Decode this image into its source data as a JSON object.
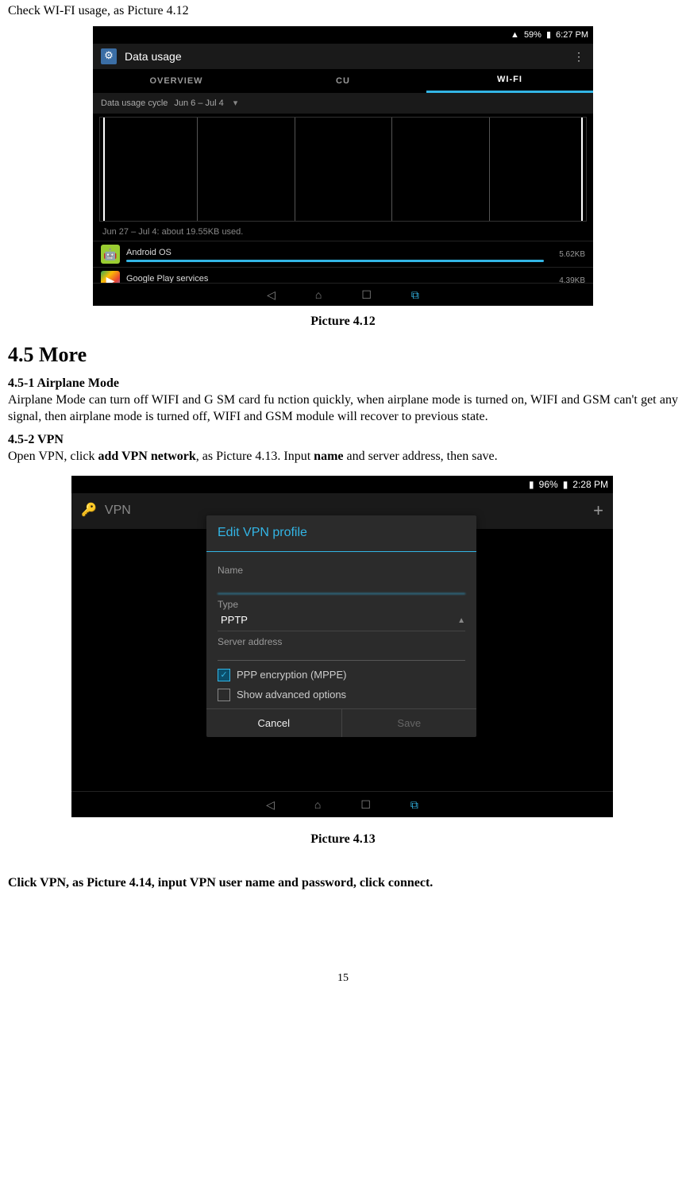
{
  "intro": "Check WI-FI usage, as Picture 4.12",
  "caption1": "Picture 4.12",
  "section_title": "4.5 More",
  "sub1_title": "4.5-1 Airplane Mode",
  "sub1_text": "Airplane Mode can turn off WIFI and G SM card fu nction quickly, when airplane mode is turned on, WIFI and GSM can't get any signal, then airplane mode is turned off, WIFI and GSM module will recover to previous state.",
  "sub2_title": "4.5-2 VPN",
  "sub2_pre": "Open VPN, click ",
  "sub2_bold1": "add VPN network",
  "sub2_mid": ", as Picture 4.13. Input ",
  "sub2_bold2": "name",
  "sub2_post": " and server address, then save.",
  "caption2": "Picture 4.13",
  "instruction2": "Click VPN, as Picture 4.14, input VPN user name and password, click connect.",
  "page_number": "15",
  "shot1": {
    "status": {
      "battery": "59%",
      "time": "6:27 PM"
    },
    "header_title": "Data usage",
    "tabs": {
      "overview": "OVERVIEW",
      "cu": "CU",
      "wifi": "WI-FI"
    },
    "cycle_label": "Data usage cycle",
    "cycle_range": "Jun 6 – Jul 4",
    "usage_text": "Jun 27 – Jul 4: about 19.55KB used.",
    "apps": [
      {
        "name": "Android OS",
        "size": "5.62KB",
        "bar_width": "98%"
      },
      {
        "name": "Google Play services",
        "size": "4.39KB",
        "bar_width": "75%"
      }
    ]
  },
  "shot2": {
    "status": {
      "battery": "96%",
      "time": "2:28 PM"
    },
    "header_title": "VPN",
    "dialog_title": "Edit VPN profile",
    "name_label": "Name",
    "type_label": "Type",
    "type_value": "PPTP",
    "server_label": "Server address",
    "ppp_label": "PPP encryption (MPPE)",
    "advanced_label": "Show advanced options",
    "cancel": "Cancel",
    "save": "Save"
  }
}
